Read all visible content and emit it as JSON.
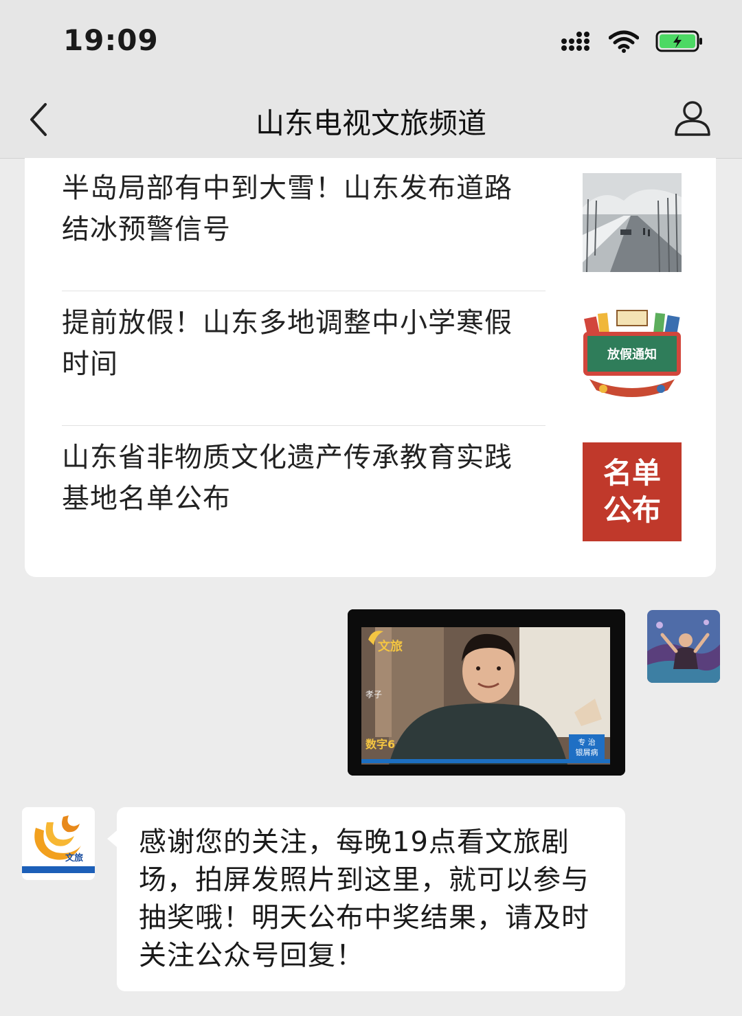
{
  "status_bar": {
    "time": "19:09",
    "battery_color": "#4cd964"
  },
  "nav": {
    "title": "山东电视文旅频道",
    "back_icon": "chevron-left-icon",
    "profile_icon": "person-icon"
  },
  "articles": [
    {
      "title": "半岛局部有中到大雪！山东发布道路结冰预警信号",
      "thumb": "snowy-road-photo"
    },
    {
      "title": "提前放假！山东多地调整中小学寒假时间",
      "thumb": "holiday-notice-image",
      "thumb_text": "放假通知"
    },
    {
      "title": "山东省非物质文化遗产传承教育实践基地名单公布",
      "thumb_text_line1": "名单",
      "thumb_text_line2": "公布",
      "thumb_color": "#c0392b"
    }
  ],
  "sent_image": {
    "logo_text": "文旅",
    "side_text": "孝子",
    "bottom_left_text": "数字6",
    "corner_text_line1": "专 治",
    "corner_text_line2": "银屑病"
  },
  "bot": {
    "avatar_label": "文旅",
    "message": "感谢您的关注，每晚19点看文旅剧场，拍屏发照片到这里，就可以参与抽奖哦！明天公布中奖结果，请及时关注公众号回复！"
  }
}
